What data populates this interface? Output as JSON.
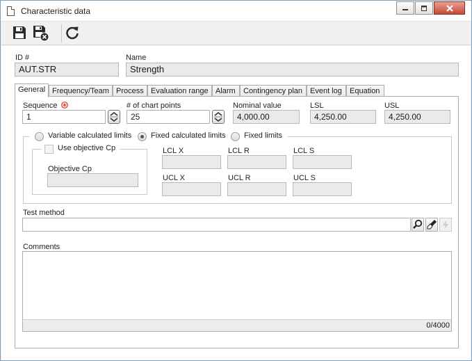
{
  "window": {
    "title": "Characteristic data"
  },
  "toolbar": {
    "save": "save-icon",
    "save_close": "save-close-icon",
    "refresh": "refresh-icon"
  },
  "header": {
    "id_label": "ID #",
    "id_value": "AUT.STR",
    "name_label": "Name",
    "name_value": "Strength"
  },
  "tabs": [
    {
      "label": "General"
    },
    {
      "label": "Frequency/Team"
    },
    {
      "label": "Process"
    },
    {
      "label": "Evaluation range"
    },
    {
      "label": "Alarm"
    },
    {
      "label": "Contingency plan"
    },
    {
      "label": "Event log"
    },
    {
      "label": "Equation"
    }
  ],
  "general": {
    "sequence_label": "Sequence",
    "sequence_value": "1",
    "points_label": "# of chart points",
    "points_value": "25",
    "nominal_label": "Nominal value",
    "nominal_value": "4,000.00",
    "lsl_label": "LSL",
    "lsl_value": "4,250.00",
    "usl_label": "USL",
    "usl_value": "4,250.00",
    "limits": {
      "variable_label": "Variable calculated limits",
      "fixed_calc_label": "Fixed calculated limits",
      "fixed_label": "Fixed limits",
      "selected": "Fixed calculated limits"
    },
    "use_objective_label": "Use objective Cp",
    "use_objective_checked": false,
    "objective_cp_label": "Objective Cp",
    "objective_cp_value": "",
    "lcl_x_label": "LCL X",
    "lcl_x_value": "",
    "lcl_r_label": "LCL R",
    "lcl_r_value": "",
    "lcl_s_label": "LCL S",
    "lcl_s_value": "",
    "ucl_x_label": "UCL X",
    "ucl_x_value": "",
    "ucl_r_label": "UCL R",
    "ucl_r_value": "",
    "ucl_s_label": "UCL S",
    "ucl_s_value": "",
    "test_method_label": "Test method",
    "test_method_value": "",
    "comments_label": "Comments",
    "comments_value": "",
    "comments_counter": "0/4000"
  },
  "colors": {
    "required": "#d83a2c",
    "tab_border": "#acacac",
    "field_border": "#abadb3"
  }
}
